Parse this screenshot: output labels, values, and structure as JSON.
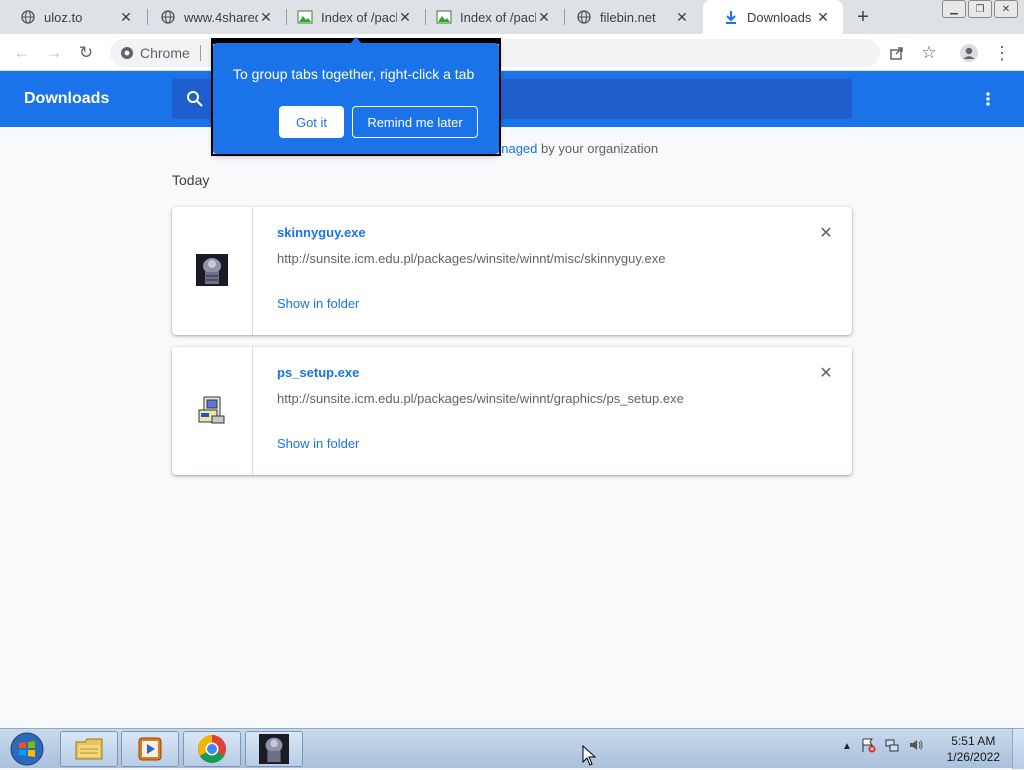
{
  "tabs": [
    {
      "title": "uloz.to",
      "favicon": "globe-icon"
    },
    {
      "title": "www.4shared.",
      "favicon": "globe-icon"
    },
    {
      "title": "Index of /pack",
      "favicon": "image-icon"
    },
    {
      "title": "Index of /pack",
      "favicon": "image-icon"
    },
    {
      "title": "filebin.net",
      "favicon": "globe-icon"
    },
    {
      "title": "Downloads",
      "favicon": "download-icon",
      "active": true
    }
  ],
  "omnibox": {
    "chip_label": "Chrome"
  },
  "header": {
    "title": "Downloads"
  },
  "managed": {
    "link_text": "anaged",
    "suffix": " by your organization"
  },
  "section_label": "Today",
  "downloads": [
    {
      "file_name": "skinnyguy.exe",
      "url": "http://sunsite.icm.edu.pl/packages/winsite/winnt/misc/skinnyguy.exe",
      "action": "Show in folder"
    },
    {
      "file_name": "ps_setup.exe",
      "url": "http://sunsite.icm.edu.pl/packages/winsite/winnt/graphics/ps_setup.exe",
      "action": "Show in folder"
    }
  ],
  "bubble": {
    "message": "To group tabs together, right-click a tab",
    "primary_button": "Got it",
    "secondary_button": "Remind me later"
  },
  "taskbar": {
    "time": "5:51 AM",
    "date": "1/26/2022"
  },
  "colors": {
    "accent": "#1a73e8",
    "header_search": "#1f5fcd"
  }
}
